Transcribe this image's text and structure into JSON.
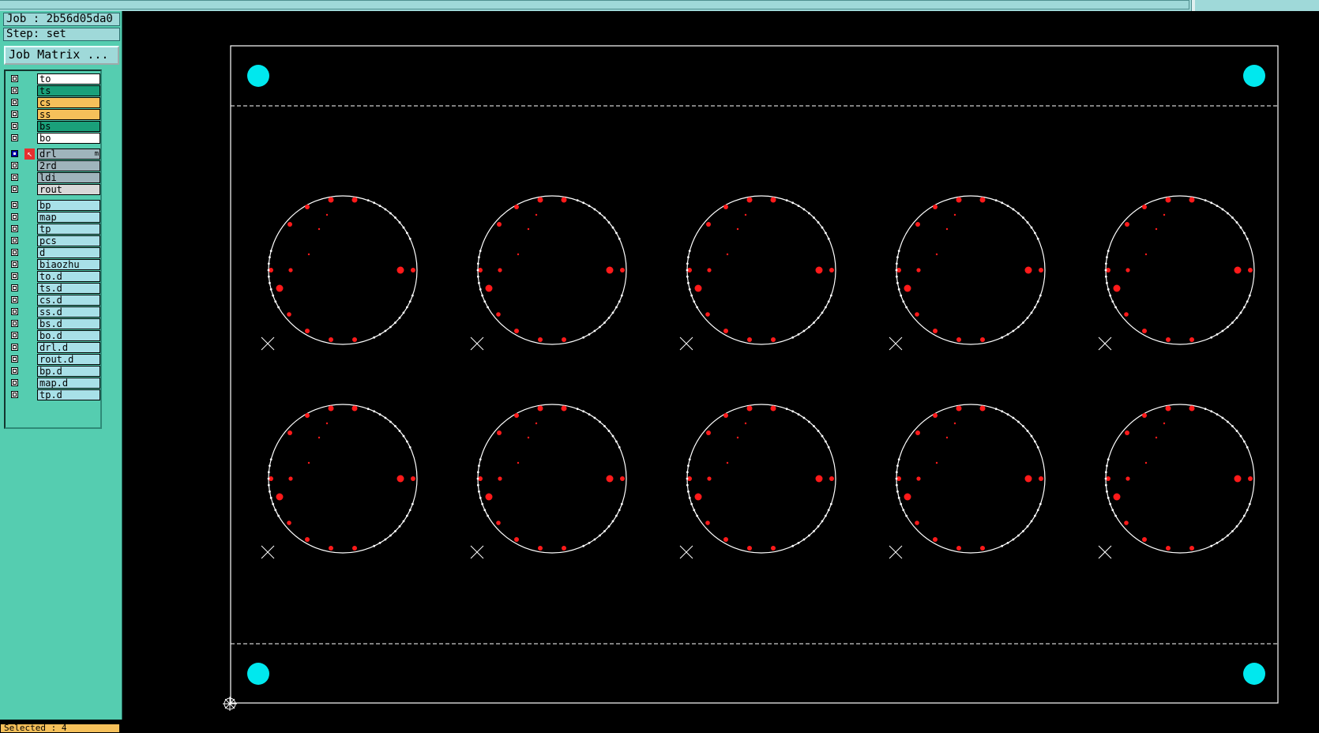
{
  "header": {
    "job_label": "Job : 2b56d05da0",
    "step_label": "Step: set",
    "job_matrix_button": "Job Matrix ..."
  },
  "colors": {
    "panel_bg": "#55cdb0",
    "canvas_bg": "#000000",
    "outline": "#ffffff",
    "pad_red": "#ff1a1a",
    "tooling_hole": "#00e8ee",
    "layer_white": "#ffffff",
    "layer_green": "#1aa07a",
    "layer_orange": "#f5c05a",
    "layer_grey": "#9fb4bc",
    "layer_cyan": "#a8e0e8"
  },
  "layers": {
    "board": [
      {
        "name": "to",
        "color": "#ffffff",
        "checked": false
      },
      {
        "name": "ts",
        "color": "#1aa07a",
        "checked": false
      },
      {
        "name": "cs",
        "color": "#f5c05a",
        "checked": false
      },
      {
        "name": "ss",
        "color": "#f5c05a",
        "checked": false
      },
      {
        "name": "bs",
        "color": "#1aa07a",
        "checked": false
      },
      {
        "name": "bo",
        "color": "#ffffff",
        "checked": false
      }
    ],
    "drill": [
      {
        "name": "drl",
        "suffix": "m",
        "color": "#9fb4bc",
        "checked": true,
        "work": true
      },
      {
        "name": "2rd",
        "color": "#9fb4bc",
        "checked": false
      },
      {
        "name": "ldi",
        "color": "#9fb4bc",
        "checked": false
      },
      {
        "name": "rout",
        "color": "#d8d8d8",
        "checked": false
      }
    ],
    "misc": [
      {
        "name": "bp",
        "color": "#a8e0e8",
        "checked": false
      },
      {
        "name": "map",
        "color": "#a8e0e8",
        "checked": false
      },
      {
        "name": "tp",
        "color": "#a8e0e8",
        "checked": false
      },
      {
        "name": "pcs",
        "color": "#a8e0e8",
        "checked": false
      },
      {
        "name": "d",
        "color": "#a8e0e8",
        "checked": false
      },
      {
        "name": "biaozhu",
        "color": "#a8e0e8",
        "checked": false
      },
      {
        "name": "to.d",
        "color": "#a8e0e8",
        "checked": false
      },
      {
        "name": "ts.d",
        "color": "#a8e0e8",
        "checked": false
      },
      {
        "name": "cs.d",
        "color": "#a8e0e8",
        "checked": false
      },
      {
        "name": "ss.d",
        "color": "#a8e0e8",
        "checked": false
      },
      {
        "name": "bs.d",
        "color": "#a8e0e8",
        "checked": false
      },
      {
        "name": "bo.d",
        "color": "#a8e0e8",
        "checked": false
      },
      {
        "name": "drl.d",
        "color": "#a8e0e8",
        "checked": false
      },
      {
        "name": "rout.d",
        "color": "#a8e0e8",
        "checked": false
      },
      {
        "name": "bp.d",
        "color": "#a8e0e8",
        "checked": false
      },
      {
        "name": "map.d",
        "color": "#a8e0e8",
        "checked": false
      },
      {
        "name": "tp.d",
        "color": "#a8e0e8",
        "checked": false
      }
    ]
  },
  "status": {
    "selected_label": "Selected : 4"
  },
  "panel_array": {
    "rows": 2,
    "cols": 5,
    "tooling_holes": 4
  }
}
